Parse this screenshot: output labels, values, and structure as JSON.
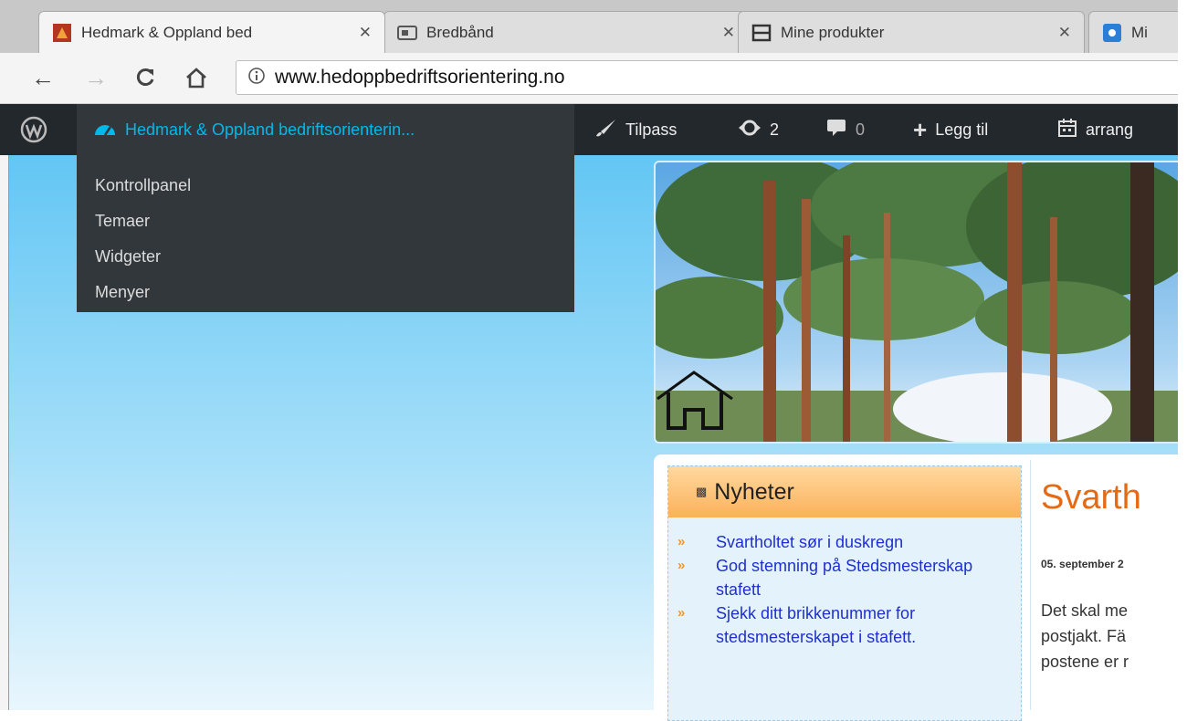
{
  "tabs": [
    {
      "label": "Hedmark & Oppland bed",
      "favicon": "site-favicon",
      "active": true
    },
    {
      "label": "Bredbånd",
      "favicon": "router-icon",
      "active": false
    },
    {
      "label": "Mine produkter",
      "favicon": "product-icon",
      "active": false
    },
    {
      "label": "Mi",
      "favicon": "blue-square-icon",
      "active": false
    }
  ],
  "address_bar": {
    "url": "www.hedoppbedriftsorientering.no"
  },
  "admin_bar": {
    "site_name": "Hedmark & Oppland bedriftsorienterin...",
    "customize": "Tilpass",
    "updates_count": "2",
    "comments_count": "0",
    "new_label": "Legg til",
    "events_label": "arrang",
    "site_menu": [
      "Kontrollpanel",
      "Temaer",
      "Widgeter",
      "Menyer"
    ]
  },
  "news": {
    "heading": "Nyheter",
    "items": [
      "Svartholtet sør i duskregn",
      "God stemning på Stedsmesterskap stafett",
      "Sjekk ditt brikkenummer for stedsmesterskapet i stafett."
    ]
  },
  "article": {
    "title": "Svarth",
    "date": "05. september 2",
    "lines": [
      "Det skal me",
      "postjakt. Fä",
      "postene er r"
    ]
  },
  "colors": {
    "admin_bar": "#23282d",
    "admin_link": "#00b9eb",
    "news_header": "#fbb15a",
    "news_link": "#1e2fd0",
    "article_title": "#e56a16",
    "page_bg": "#63c6f4"
  }
}
